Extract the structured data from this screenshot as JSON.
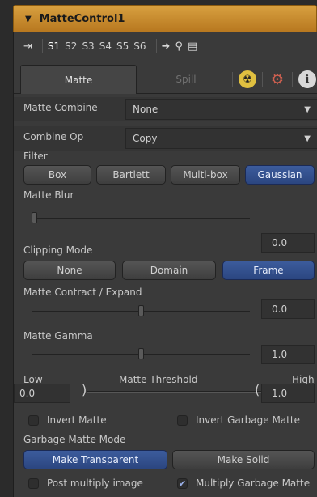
{
  "header": {
    "title": "MatteControl1"
  },
  "toolbar": {
    "slots": [
      "S1",
      "S2",
      "S3",
      "S4",
      "S5",
      "S6"
    ],
    "active_slot": "S1"
  },
  "tabs": {
    "matte": "Matte",
    "spill": "Spill"
  },
  "matte_combine": {
    "label": "Matte Combine",
    "value": "None"
  },
  "combine_op": {
    "label": "Combine Op",
    "value": "Copy"
  },
  "filter": {
    "label": "Filter",
    "options": [
      "Box",
      "Bartlett",
      "Multi-box",
      "Gaussian"
    ],
    "selected": "Gaussian"
  },
  "matte_blur": {
    "label": "Matte Blur",
    "value": "0.0",
    "level": 0.0
  },
  "clipping_mode": {
    "label": "Clipping Mode",
    "options": [
      "None",
      "Domain",
      "Frame"
    ],
    "selected": "Frame"
  },
  "contract_expand": {
    "label": "Matte Contract / Expand",
    "value": "0.0",
    "level": 0.5
  },
  "matte_gamma": {
    "label": "Matte Gamma",
    "value": "1.0",
    "level": 0.5
  },
  "threshold": {
    "label": "Matte Threshold",
    "low_label": "Low",
    "high_label": "High",
    "low_value": "0.0",
    "high_value": "1.0"
  },
  "invert_matte": {
    "label": "Invert Matte",
    "checked": false
  },
  "invert_garbage": {
    "label": "Invert Garbage Matte",
    "checked": false
  },
  "garbage_mode": {
    "label": "Garbage Matte Mode",
    "options": [
      "Make Transparent",
      "Make Solid"
    ],
    "selected": "Make Transparent"
  },
  "post_multiply": {
    "label": "Post multiply image",
    "checked": false
  },
  "multiply_garbage": {
    "label": "Multiply Garbage Matte",
    "checked": true
  },
  "colors": {
    "header": "#c88c30",
    "accent": "#2f4c8a"
  }
}
